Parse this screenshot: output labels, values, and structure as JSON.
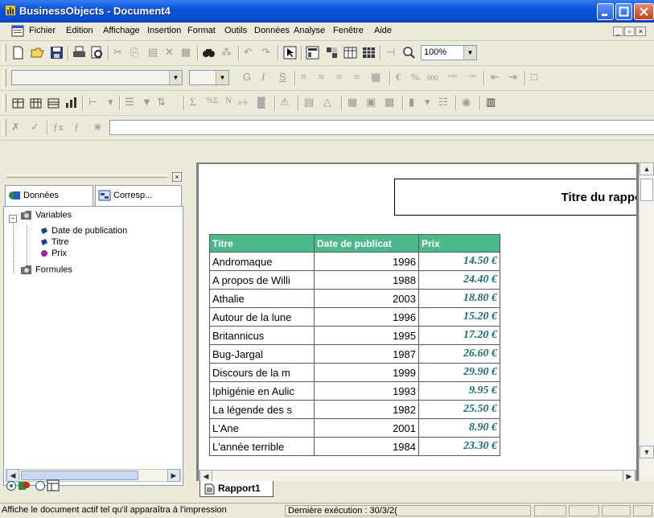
{
  "window": {
    "title": "BusinessObjects - Document4"
  },
  "menu": {
    "items": [
      "Fichier",
      "Edition",
      "Affichage",
      "Insertion",
      "Format",
      "Outils",
      "Données",
      "Analyse",
      "Fenêtre",
      "Aide"
    ]
  },
  "toolbar": {
    "zoom": "100%",
    "bold": "G",
    "italic": "I",
    "underline": "S",
    "currency": "€",
    "percent": "%",
    "thousands": "000"
  },
  "left_panel": {
    "tabs": [
      "Données",
      "Corresp..."
    ],
    "tree": {
      "root": "Variables",
      "children": [
        "Date de publication",
        "Titre",
        "Prix"
      ],
      "formulas": "Formules"
    }
  },
  "report": {
    "title": "Titre du rapport",
    "columns": [
      "Titre",
      "Date de publicat",
      "Prix"
    ],
    "rows": [
      [
        "Andromaque",
        "1996",
        "14.50 €"
      ],
      [
        "A propos de Willi",
        "1988",
        "24.40 €"
      ],
      [
        "Athalie",
        "2003",
        "18.80 €"
      ],
      [
        "Autour de la lune",
        "1996",
        "15.20 €"
      ],
      [
        "Britannicus",
        "1995",
        "17.20 €"
      ],
      [
        "Bug-Jargal",
        "1987",
        "26.60 €"
      ],
      [
        "Discours de la m",
        "1999",
        "29.90 €"
      ],
      [
        "Iphigénie en Aulic",
        "1993",
        "9.95 €"
      ],
      [
        "La légende des s",
        "1982",
        "25.50 €"
      ],
      [
        "L'Ane",
        "2001",
        "8.90 €"
      ],
      [
        "L'année terrible",
        "1984",
        "23.30 €"
      ]
    ],
    "sheet_tab": "Rapport1"
  },
  "status": {
    "message": "Affiche le document actif tel qu'il apparaîtra à l'impression",
    "last_run": "Dernière exécution : 30/3/2("
  },
  "colors": {
    "header_green": "#4cb98c",
    "price_teal": "#1a6e72",
    "titlebar_blue": "#0a54d8"
  }
}
